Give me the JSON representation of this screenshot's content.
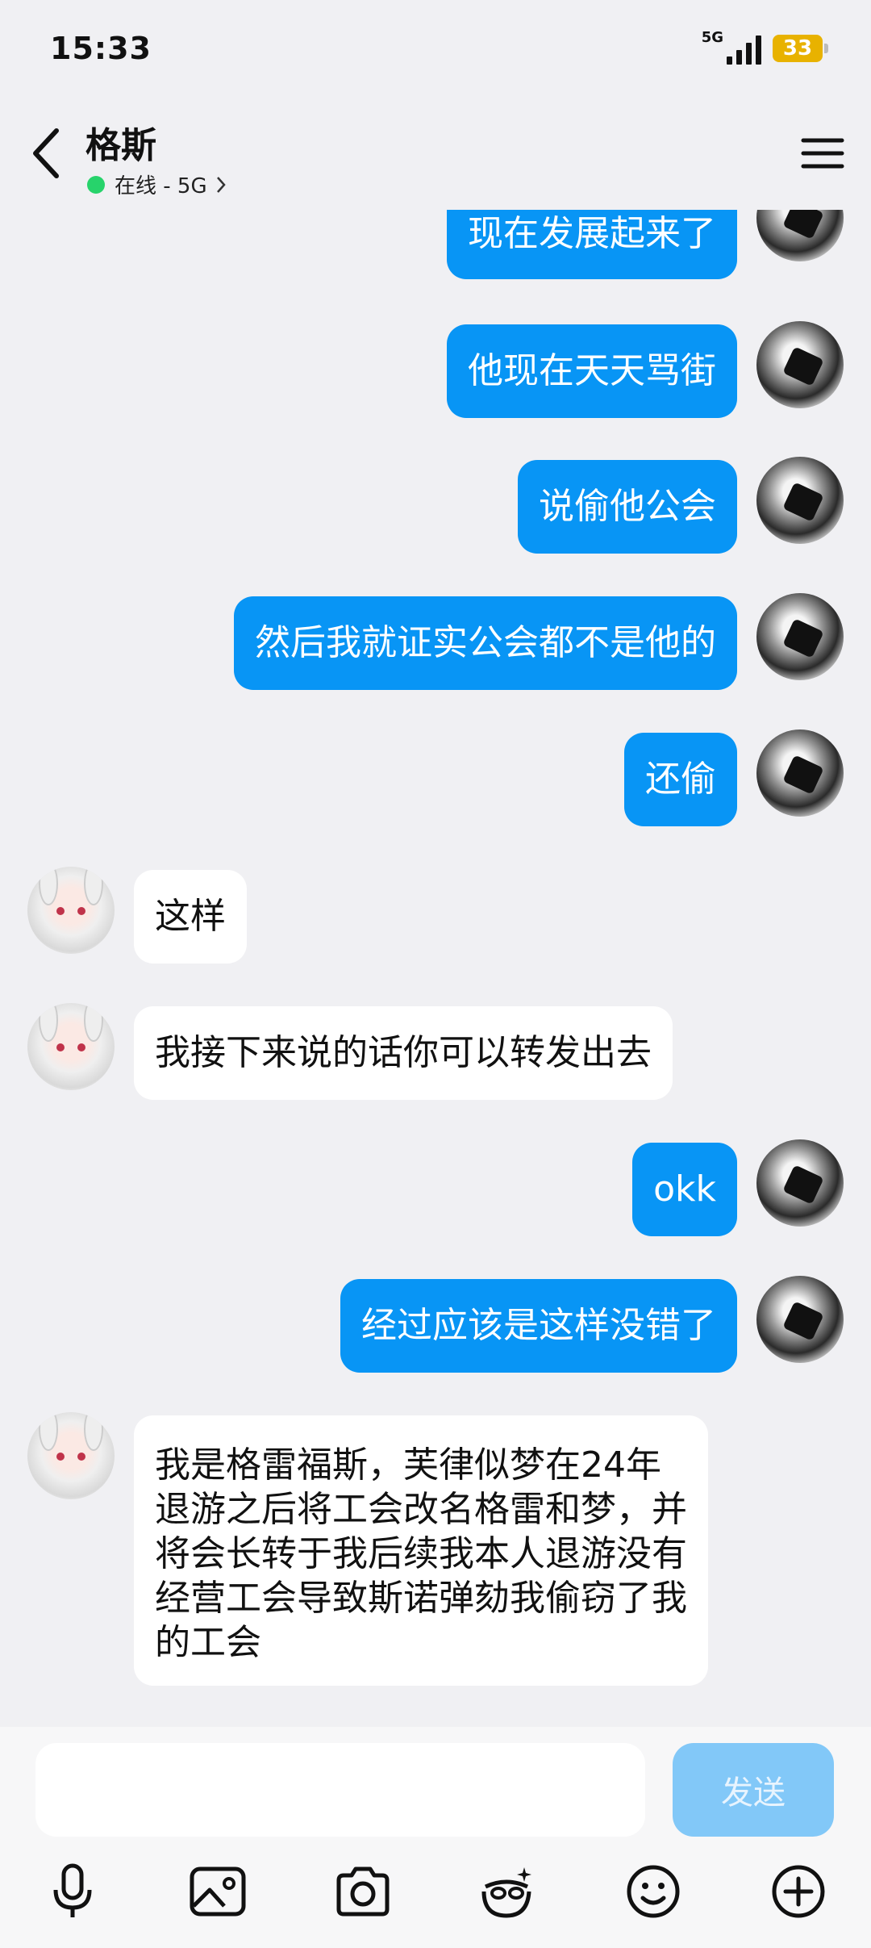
{
  "status": {
    "time": "15:33",
    "network": "5G",
    "battery": "33"
  },
  "header": {
    "contact_name": "格斯",
    "status_text": "在线 - 5G"
  },
  "messages": [
    {
      "side": "right",
      "text": "现在发展起来了"
    },
    {
      "side": "right",
      "text": "他现在天天骂街"
    },
    {
      "side": "right",
      "text": "说偷他公会"
    },
    {
      "side": "right",
      "text": "然后我就证实公会都不是他的"
    },
    {
      "side": "right",
      "text": "还偷"
    },
    {
      "side": "left",
      "text": "这样"
    },
    {
      "side": "left",
      "text": "我接下来说的话你可以转发出去"
    },
    {
      "side": "right",
      "text": "okk"
    },
    {
      "side": "right",
      "text": "经过应该是这样没错了"
    },
    {
      "side": "left",
      "text": "我是格雷福斯，芙律似梦在24年退游之后将工会改名格雷和梦，并将会长转于我后续我本人退游没有经营工会导致斯诺弹劾我偷窃了我的工会"
    }
  ],
  "input": {
    "placeholder": "",
    "send_label": "发送"
  },
  "toolbar": [
    "microphone-icon",
    "image-icon",
    "camera-icon",
    "sticker-icon",
    "emoji-icon",
    "plus-icon"
  ],
  "colors": {
    "sent_bubble": "#0895f5",
    "received_bubble": "#ffffff",
    "online": "#27d36b",
    "battery": "#e8b200"
  }
}
